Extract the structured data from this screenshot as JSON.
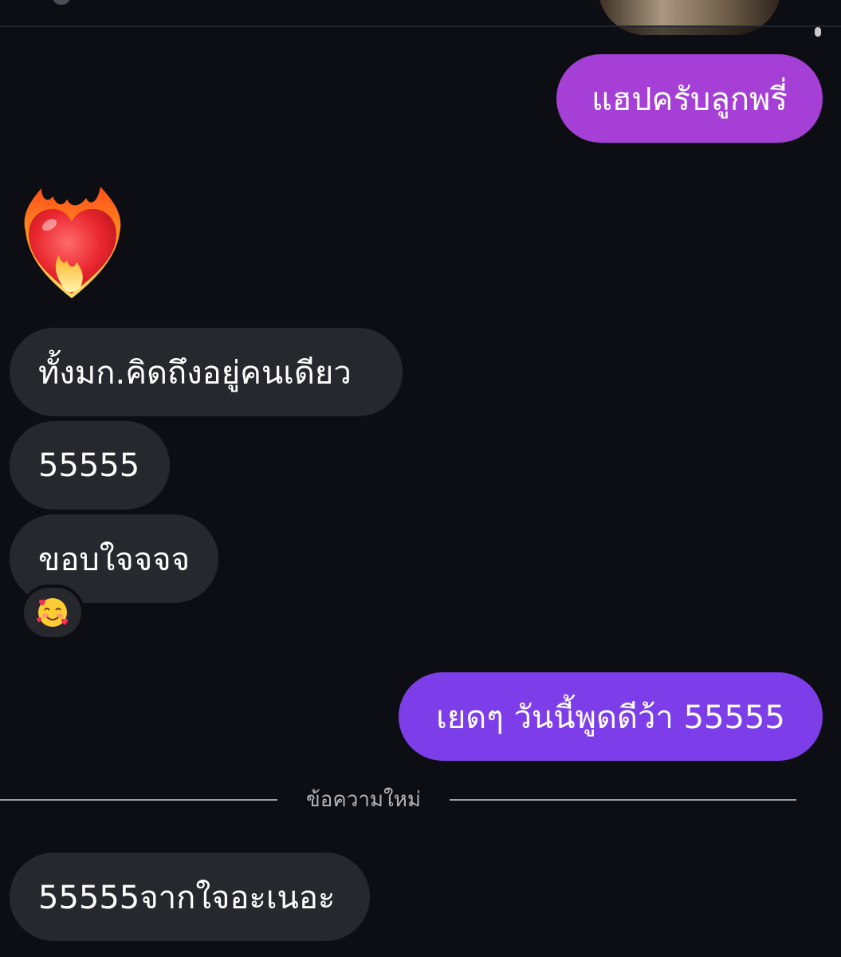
{
  "chat": {
    "messages": [
      {
        "direction": "outgoing",
        "text": "แฮปครับลูกพรี่",
        "color": "#a53fd6"
      },
      {
        "direction": "incoming",
        "type": "emoji",
        "emoji": "heart-on-fire"
      },
      {
        "direction": "incoming",
        "text": "ทั้งมก.คิดถึงอยู่คนเดียว"
      },
      {
        "direction": "incoming",
        "text": "55555"
      },
      {
        "direction": "incoming",
        "text": "ขอบใจจจจ",
        "reaction": "smiling-face-with-hearts"
      },
      {
        "direction": "outgoing",
        "text": "เยดๆ วันนี้พูดดีว้า 55555",
        "color": "#7d3ee9"
      },
      {
        "direction": "incoming",
        "text": "55555จากใจอะเนอะ"
      }
    ],
    "new_messages_label": "ข้อความใหม่"
  },
  "colors": {
    "background": "#0c0e13",
    "incoming_bubble": "#26282d",
    "outgoing_bubble_1": "#a53fd6",
    "outgoing_bubble_2": "#7d3ee9"
  }
}
